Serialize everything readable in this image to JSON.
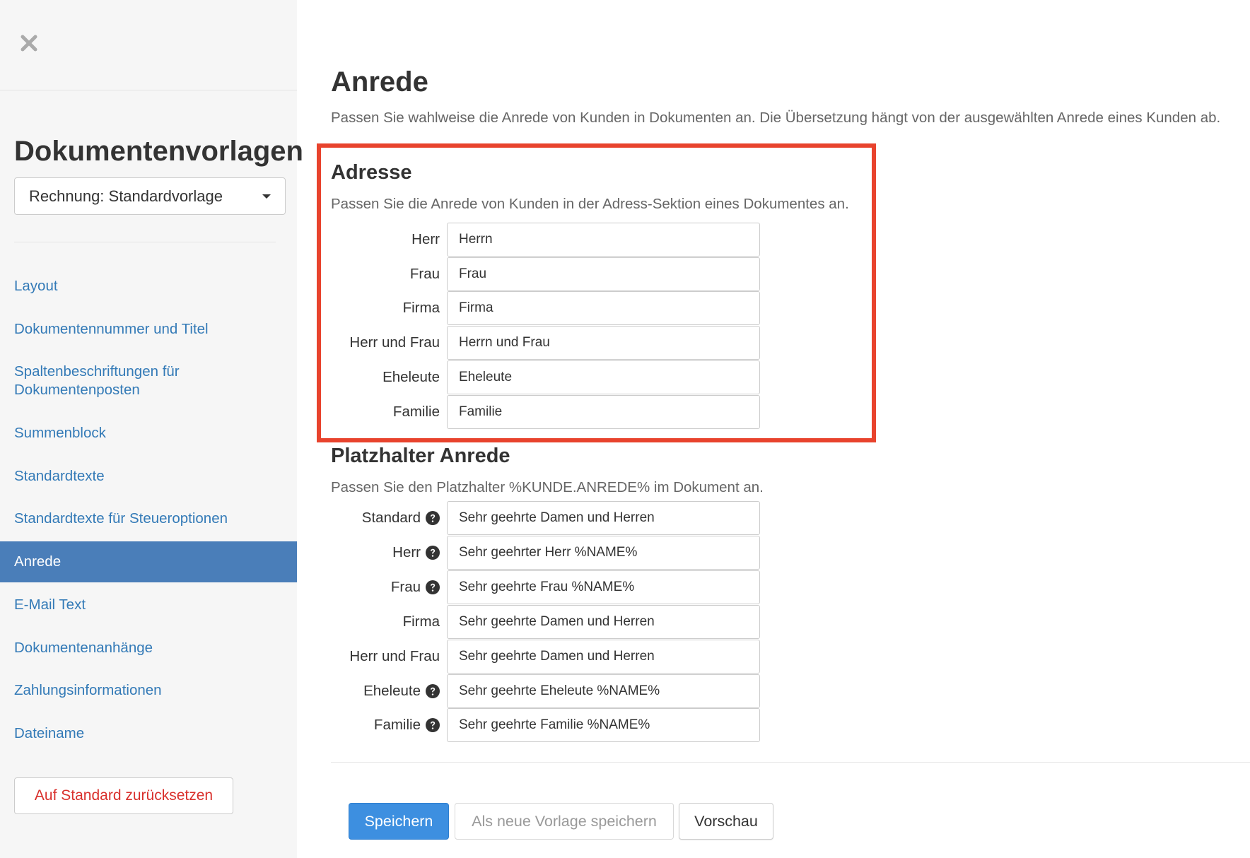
{
  "sidebar": {
    "title": "Dokumentenvorlagen",
    "template_select": {
      "value": "Rechnung: Standardvorlage"
    },
    "nav_items": [
      {
        "label": "Layout",
        "active": false
      },
      {
        "label": "Dokumentennummer und Titel",
        "active": false
      },
      {
        "label": "Spaltenbeschriftungen für Dokumentenposten",
        "active": false
      },
      {
        "label": "Summenblock",
        "active": false
      },
      {
        "label": "Standardtexte",
        "active": false
      },
      {
        "label": "Standardtexte für Steueroptionen",
        "active": false
      },
      {
        "label": "Anrede",
        "active": true
      },
      {
        "label": "E-Mail Text",
        "active": false
      },
      {
        "label": "Dokumentenanhänge",
        "active": false
      },
      {
        "label": "Zahlungsinformationen",
        "active": false
      },
      {
        "label": "Dateiname",
        "active": false
      }
    ],
    "reset_button": "Auf Standard zurücksetzen"
  },
  "main": {
    "title": "Anrede",
    "description": "Passen Sie wahlweise die Anrede von Kunden in Dokumenten an. Die Übersetzung hängt von der ausgewählten Anrede eines Kunden ab.",
    "address_section": {
      "title": "Adresse",
      "description": "Passen Sie die Anrede von Kunden in der Adress-Sektion eines Dokumentes an.",
      "fields": [
        {
          "label": "Herr",
          "value": "Herrn"
        },
        {
          "label": "Frau",
          "value": "Frau"
        },
        {
          "label": "Firma",
          "value": "Firma"
        },
        {
          "label": "Herr und Frau",
          "value": "Herrn und Frau"
        },
        {
          "label": "Eheleute",
          "value": "Eheleute"
        },
        {
          "label": "Familie",
          "value": "Familie"
        }
      ]
    },
    "placeholder_section": {
      "title": "Platzhalter Anrede",
      "description": "Passen Sie den Platzhalter %KUNDE.ANREDE% im Dokument an.",
      "fields": [
        {
          "label": "Standard",
          "value": "Sehr geehrte Damen und Herren",
          "help": true
        },
        {
          "label": "Herr",
          "value": "Sehr geehrter Herr %NAME%",
          "help": true
        },
        {
          "label": "Frau",
          "value": "Sehr geehrte Frau %NAME%",
          "help": true
        },
        {
          "label": "Firma",
          "value": "Sehr geehrte Damen und Herren",
          "help": false
        },
        {
          "label": "Herr und Frau",
          "value": "Sehr geehrte Damen und Herren",
          "help": false
        },
        {
          "label": "Eheleute",
          "value": "Sehr geehrte Eheleute %NAME%",
          "help": true
        },
        {
          "label": "Familie",
          "value": "Sehr geehrte Familie %NAME%",
          "help": true
        }
      ]
    },
    "buttons": {
      "save": "Speichern",
      "save_as_new": "Als neue Vorlage speichern",
      "preview": "Vorschau"
    }
  },
  "colors": {
    "link": "#337ab7",
    "active_nav": "#4a7eb9",
    "primary": "#3d8fe0",
    "danger": "#d9302c",
    "highlight_border": "#e8432d"
  },
  "icons": {
    "close": "close-icon",
    "dropdown": "chevron-down-icon",
    "help": "question-circle-icon"
  }
}
